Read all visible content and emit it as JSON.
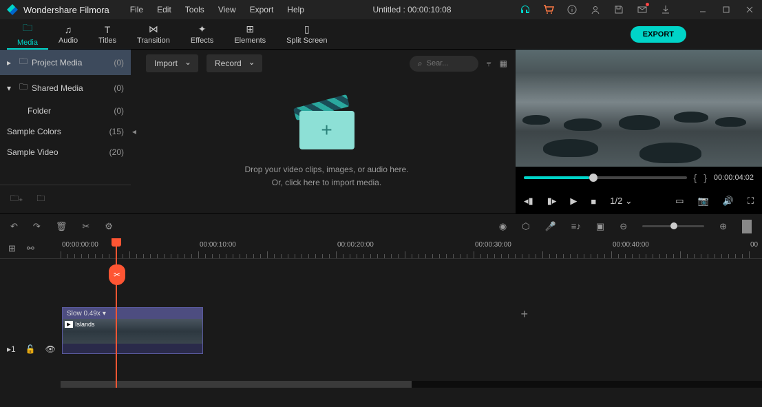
{
  "app": {
    "name": "Wondershare Filmora",
    "title": "Untitled : 00:00:10:08"
  },
  "menu": {
    "file": "File",
    "edit": "Edit",
    "tools": "Tools",
    "view": "View",
    "export": "Export",
    "help": "Help"
  },
  "tabs": {
    "media": "Media",
    "audio": "Audio",
    "titles": "Titles",
    "transition": "Transition",
    "effects": "Effects",
    "elements": "Elements",
    "split": "Split Screen"
  },
  "export_btn": "EXPORT",
  "sidebar": {
    "project_media": {
      "label": "Project Media",
      "count": "(0)"
    },
    "shared_media": {
      "label": "Shared Media",
      "count": "(0)"
    },
    "folder": {
      "label": "Folder",
      "count": "(0)"
    },
    "sample_colors": {
      "label": "Sample Colors",
      "count": "(15)"
    },
    "sample_video": {
      "label": "Sample Video",
      "count": "(20)"
    }
  },
  "content": {
    "import": "Import",
    "record": "Record",
    "search_placeholder": "Sear...",
    "drop_line1": "Drop your video clips, images, or audio here.",
    "drop_line2": "Or, click here to import media."
  },
  "preview": {
    "timecode": "00:00:04:02",
    "ratio": "1/2"
  },
  "timeline": {
    "t0": "00:00:00:00",
    "t1": "00:00:10:00",
    "t2": "00:00:20:00",
    "t3": "00:00:30:00",
    "t4": "00:00:40:00",
    "t5": "00",
    "clip_speed": "Slow 0.49x",
    "clip_name": "Islands",
    "track_num": "1"
  }
}
